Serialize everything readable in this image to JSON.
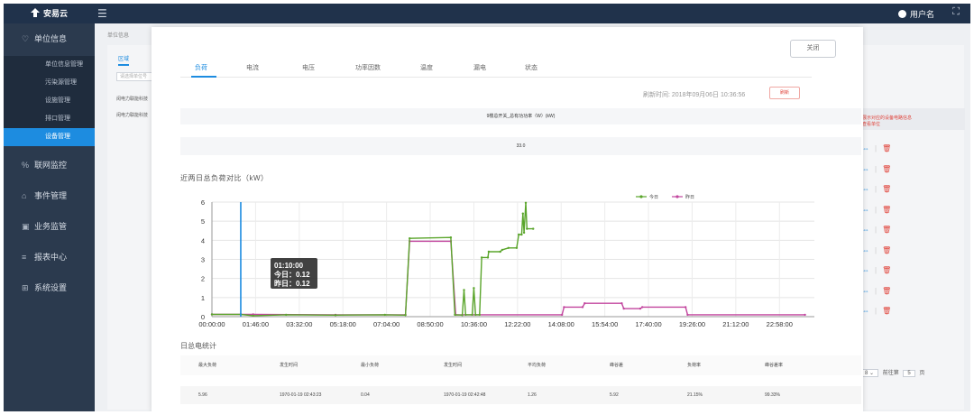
{
  "app": {
    "logo_text": "安易云",
    "user_name": "用户名"
  },
  "sidebar": {
    "groups": [
      {
        "label": "单位信息",
        "icon": "heart-icon",
        "items": [
          {
            "label": "单位信息管理"
          },
          {
            "label": "污染源管理"
          },
          {
            "label": "设施管理"
          },
          {
            "label": "排口管理"
          },
          {
            "label": "设备管理",
            "active": true
          }
        ]
      },
      {
        "label": "联网监控",
        "icon": "percent-icon"
      },
      {
        "label": "事件管理",
        "icon": "home-icon"
      },
      {
        "label": "业务监管",
        "icon": "monitor-icon"
      },
      {
        "label": "报表中心",
        "icon": "chart-icon"
      },
      {
        "label": "系统设置",
        "icon": "grid-icon"
      }
    ]
  },
  "background": {
    "breadcrumb": "单位信息",
    "tab": "区域",
    "search_placeholder": "请选择单位号",
    "rows": [
      "闵电力联能科技",
      "闵电力联能科技"
    ],
    "right_note_line1": "展示对应的设备电路信息",
    "right_note_line2": "查看单位",
    "op_rows": 9,
    "pager": {
      "page_size": "8",
      "goto_label": "前往第",
      "page": "5",
      "page_suffix": "页"
    }
  },
  "modal": {
    "close_label": "关闭",
    "tabs": [
      {
        "label": "负荷",
        "active": true
      },
      {
        "label": "电流"
      },
      {
        "label": "电压"
      },
      {
        "label": "功率因数"
      },
      {
        "label": "温度"
      },
      {
        "label": "漏电"
      },
      {
        "label": "状态"
      }
    ],
    "refresh_time": "刷新时间: 2018年09月06日 10:36:56",
    "refresh_button": "刷新",
    "power_label": "9楼总开关_总有功功率（W）(kW)",
    "power_value": "33.0",
    "chart_title": "近两日总负荷对比（kW）",
    "tooltip": {
      "time": "01:10:00",
      "today": "今日：0.12",
      "yesterday": "昨日：0.12"
    },
    "stats_title": "日总电统计",
    "stats_headers": [
      "最大负荷",
      "发生时间",
      "最小负荷",
      "发生时间",
      "平均负荷",
      "峰谷差",
      "负荷率",
      "峰谷差率"
    ],
    "stats_values": [
      "5.96",
      "1970-01-19 02:43:23",
      "0.04",
      "1970-01-19 02:42:48",
      "1.26",
      "5.92",
      "21.15%",
      "99.33%"
    ]
  },
  "chart_data": {
    "type": "line",
    "title": "近两日总负荷对比（kW）",
    "xlabel": "",
    "ylabel": "",
    "ylim": [
      0,
      6
    ],
    "yticks": [
      0,
      1,
      2,
      3,
      4,
      5,
      6
    ],
    "categories": [
      "00:00:00",
      "01:46:00",
      "03:32:00",
      "05:18:00",
      "07:04:00",
      "08:50:00",
      "10:36:00",
      "12:22:00",
      "14:08:00",
      "15:54:00",
      "17:40:00",
      "19:26:00",
      "21:12:00",
      "22:58:00"
    ],
    "legend_position": "top-right",
    "grid": true,
    "series": [
      {
        "name": "今日",
        "color": "#5aa52b",
        "points": [
          [
            0,
            0.12
          ],
          [
            70,
            0.12
          ],
          [
            100,
            0.05
          ],
          [
            180,
            0.1
          ],
          [
            300,
            0.08
          ],
          [
            420,
            0.1
          ],
          [
            470,
            0.08
          ],
          [
            480,
            4.1
          ],
          [
            580,
            4.15
          ],
          [
            590,
            0.1
          ],
          [
            608,
            0.08
          ],
          [
            612,
            1.4
          ],
          [
            616,
            0.1
          ],
          [
            632,
            0.1
          ],
          [
            636,
            1.5
          ],
          [
            640,
            0.1
          ],
          [
            650,
            0.1
          ],
          [
            655,
            3.1
          ],
          [
            670,
            3.1
          ],
          [
            672,
            3.4
          ],
          [
            700,
            3.4
          ],
          [
            705,
            3.5
          ],
          [
            720,
            3.6
          ],
          [
            740,
            3.6
          ],
          [
            745,
            4.3
          ],
          [
            752,
            4.3
          ],
          [
            755,
            5.4
          ],
          [
            758,
            4.4
          ],
          [
            762,
            5.96
          ],
          [
            765,
            4.6
          ],
          [
            780,
            4.6
          ]
        ]
      },
      {
        "name": "昨日",
        "color": "#c2459e",
        "points": [
          [
            0,
            0.12
          ],
          [
            70,
            0.12
          ],
          [
            100,
            0.12
          ],
          [
            300,
            0.1
          ],
          [
            470,
            0.1
          ],
          [
            480,
            3.95
          ],
          [
            580,
            3.95
          ],
          [
            592,
            0.1
          ],
          [
            850,
            0.1
          ],
          [
            855,
            0.5
          ],
          [
            900,
            0.5
          ],
          [
            905,
            0.7
          ],
          [
            995,
            0.7
          ],
          [
            1000,
            0.42
          ],
          [
            1040,
            0.42
          ],
          [
            1045,
            0.5
          ],
          [
            1150,
            0.5
          ],
          [
            1155,
            0.1
          ],
          [
            1440,
            0.1
          ]
        ]
      }
    ],
    "cursor_time_minutes": 70
  }
}
